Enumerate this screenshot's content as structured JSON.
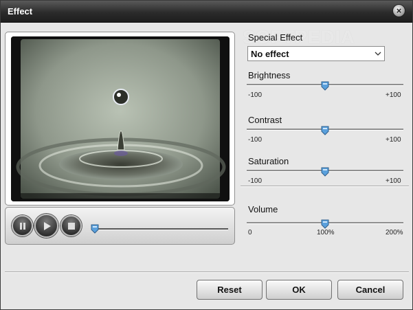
{
  "window": {
    "title": "Effect",
    "close_label": "×"
  },
  "watermark": "SOFTPEDIA",
  "player": {
    "buttons": [
      {
        "name": "pause-button",
        "icon": "pause-icon"
      },
      {
        "name": "play-button",
        "icon": "play-icon"
      },
      {
        "name": "stop-button",
        "icon": "stop-icon"
      }
    ],
    "seek_position": 0.0
  },
  "special_effect": {
    "label": "Special Effect",
    "selected": "No effect"
  },
  "brightness": {
    "label": "Brightness",
    "min_label": "-100",
    "max_label": "+100",
    "value": 0
  },
  "contrast": {
    "label": "Contrast",
    "min_label": "-100",
    "max_label": "+100",
    "value": 0
  },
  "saturation": {
    "label": "Saturation",
    "min_label": "-100",
    "max_label": "+100",
    "value": 0
  },
  "volume": {
    "label": "Volume",
    "min_label": "0",
    "mid_label": "100%",
    "max_label": "200%",
    "value_percent": 100
  },
  "footer": {
    "reset_label": "Reset",
    "ok_label": "OK",
    "cancel_label": "Cancel"
  },
  "colors": {
    "titlebar": "#2b2b2b",
    "dialog_bg": "#e7e7e7",
    "thumb": "#5aa0dc"
  }
}
